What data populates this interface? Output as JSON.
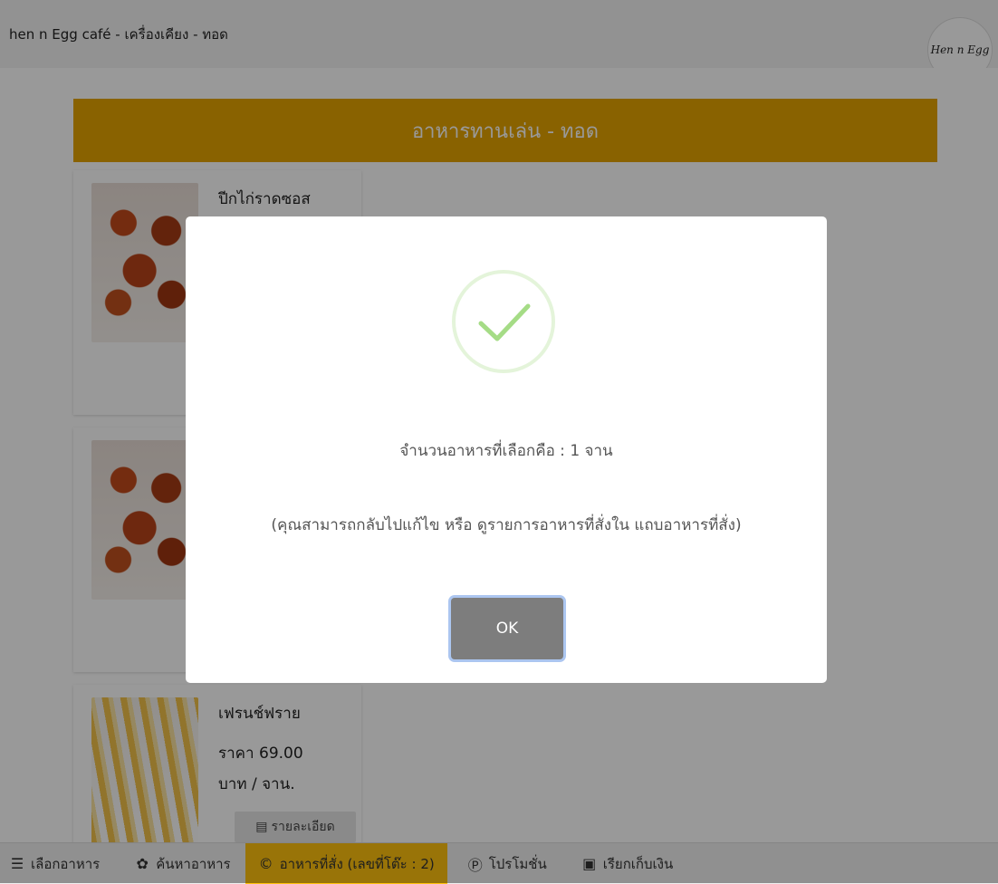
{
  "header": {
    "title": "hen n Egg café - เครื่องเคียง - ทอด",
    "logo_text": "Hen n Egg"
  },
  "category": {
    "title": "อาหารทานเล่น - ทอด"
  },
  "items": [
    {
      "name": "ปีกไก่ราดซอส"
    },
    {
      "name": ""
    },
    {
      "name": "เฟรนช์ฟราย",
      "price": "ราคา 69.00",
      "unit": "บาท / จาน.",
      "details_label": "รายละเอียด"
    }
  ],
  "modal": {
    "message": "จำนวนอาหารที่เลือกคือ : 1 จาน",
    "hint": "(คุณสามารถกลับไปแก้ไข หรือ ดูรายการอาหารที่สั่งใน แถบอาหารที่สั่ง)",
    "ok_label": "OK"
  },
  "bottom_nav": [
    {
      "label": "เลือกอาหาร",
      "icon": "menu-icon"
    },
    {
      "label": "ค้นหาอาหาร",
      "icon": "leaf-icon"
    },
    {
      "label": "อาหารที่สั่ง (เลขที่โต๊ะ : 2)",
      "icon": "copyright-icon",
      "active": true
    },
    {
      "label": "โปรโมชั่น",
      "icon": "promo-icon"
    },
    {
      "label": "เรียกเก็บเงิน",
      "icon": "money-icon"
    }
  ],
  "colors": {
    "banner": "#e5a400",
    "active_tab": "#ffc20e",
    "ok_button": "#7d7d7d",
    "success": "#a5dc86"
  }
}
